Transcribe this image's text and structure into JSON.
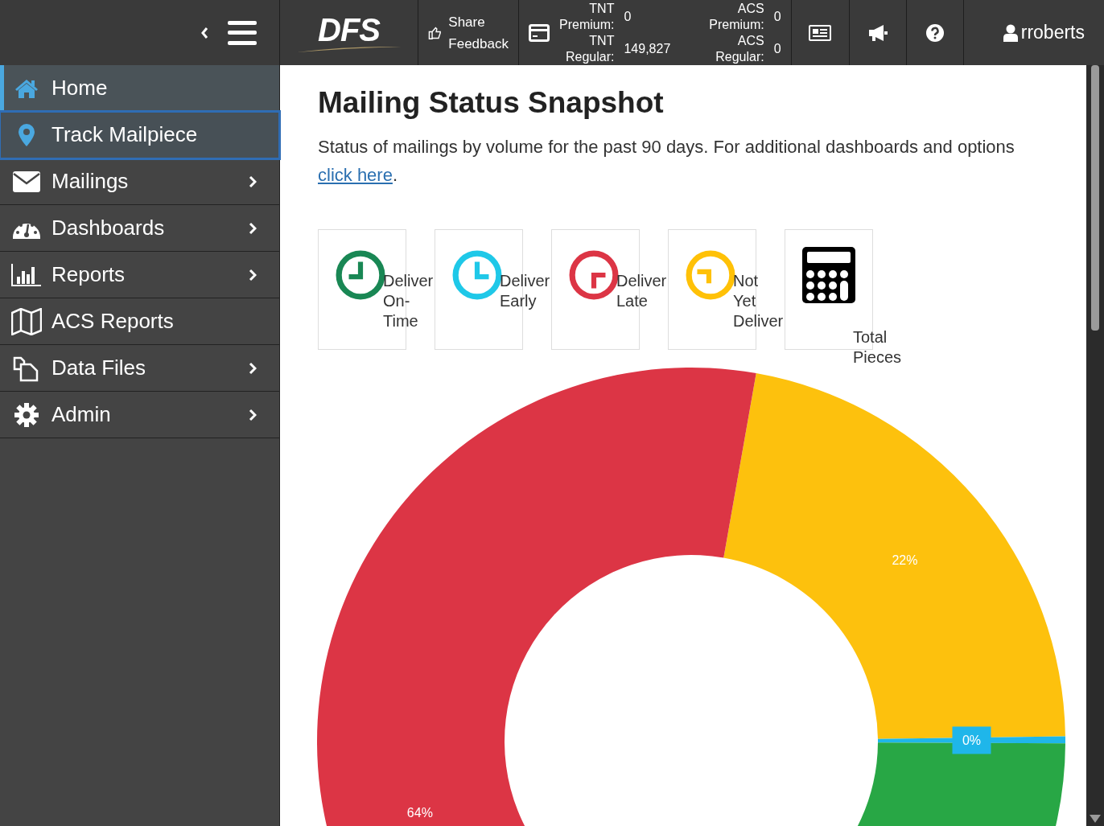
{
  "header": {
    "logo": "DFS",
    "share_feedback": [
      "Share",
      "Feedback"
    ],
    "counters": [
      {
        "label": [
          "TNT",
          "Premium:"
        ],
        "value": "0"
      },
      {
        "label": [
          "TNT",
          "Regular:"
        ],
        "value": "149,827"
      },
      {
        "label": [
          "ACS",
          "Premium:"
        ],
        "value": "0"
      },
      {
        "label": [
          "ACS",
          "Regular:"
        ],
        "value": "0"
      }
    ],
    "user": "rroberts"
  },
  "sidebar": {
    "items": [
      {
        "label": "Home",
        "selected": true,
        "focused": false,
        "expandable": false
      },
      {
        "label": "Track Mailpiece",
        "selected": false,
        "focused": true,
        "expandable": false
      },
      {
        "label": "Mailings",
        "selected": false,
        "focused": false,
        "expandable": true
      },
      {
        "label": "Dashboards",
        "selected": false,
        "focused": false,
        "expandable": true
      },
      {
        "label": "Reports",
        "selected": false,
        "focused": false,
        "expandable": true
      },
      {
        "label": "ACS Reports",
        "selected": false,
        "focused": false,
        "expandable": false
      },
      {
        "label": "Data Files",
        "selected": false,
        "focused": false,
        "expandable": true
      },
      {
        "label": "Admin",
        "selected": false,
        "focused": false,
        "expandable": true
      }
    ]
  },
  "main": {
    "title": "Mailing Status Snapshot",
    "description": "Status of mailings by volume for the past 90 days. For additional dashboards and options",
    "link": "click here",
    "link_suffix": ".",
    "cards": [
      {
        "kind": "clock",
        "color": "#198754",
        "label": "Deliver On-Time"
      },
      {
        "kind": "clock",
        "color": "#1fc8e8",
        "label": "Deliver Early"
      },
      {
        "kind": "clock",
        "color": "#dc3545",
        "label": "Deliver Late"
      },
      {
        "kind": "clock",
        "color": "#ffc107",
        "label": "Not Yet Deliver"
      },
      {
        "kind": "calculator",
        "label": "Total Pieces"
      }
    ],
    "chart_data": {
      "type": "donut",
      "series": [
        {
          "values": [
            22,
            0.3,
            14,
            63.7
          ]
        }
      ],
      "colors": [
        "#fdc10d",
        "#1fb6ea",
        "#28a745",
        "#dc3545"
      ],
      "value_labels": [
        "22%",
        "0%",
        null,
        "64%"
      ]
    }
  }
}
